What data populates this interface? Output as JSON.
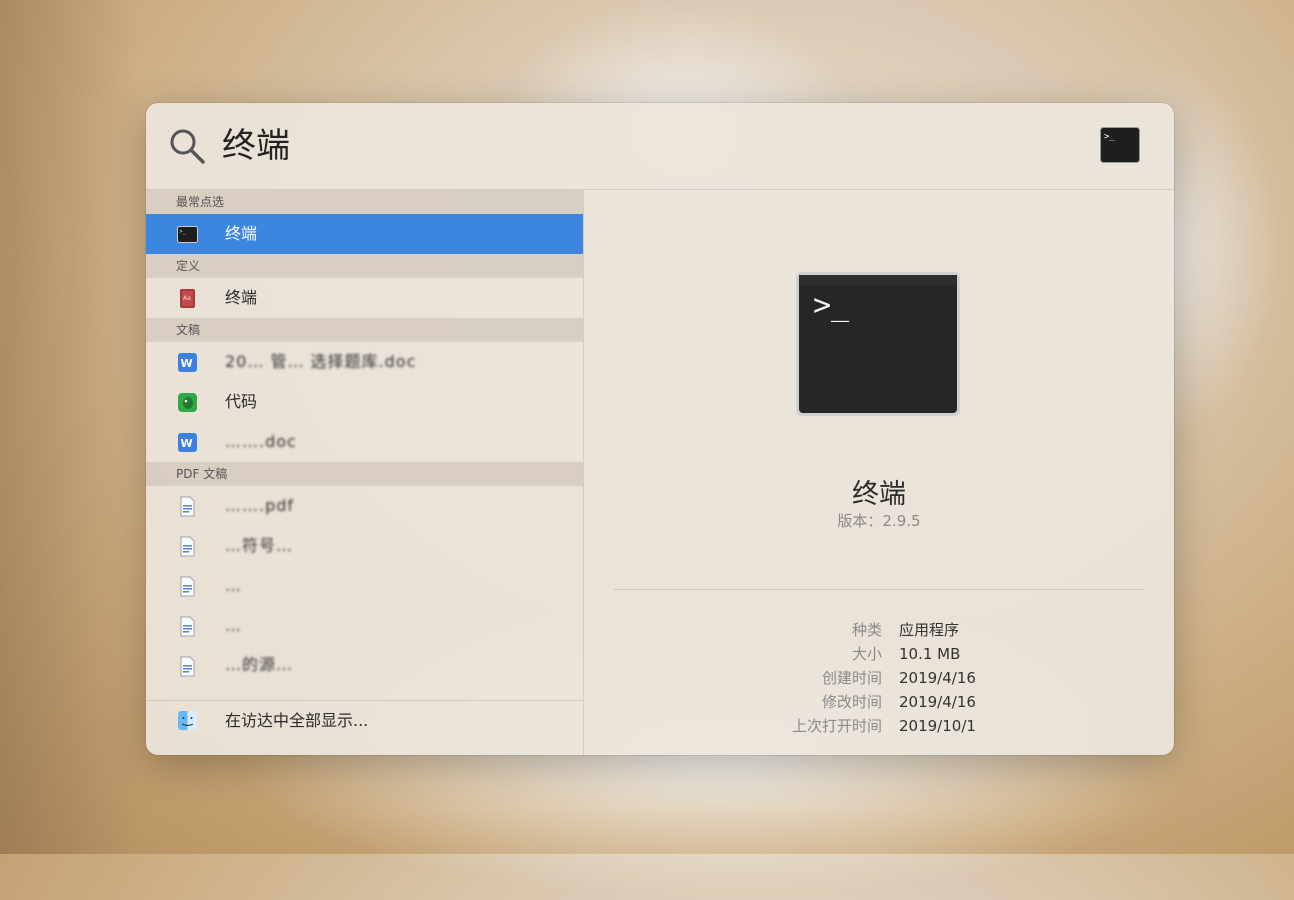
{
  "search": {
    "query": "终端"
  },
  "results": {
    "sections": [
      {
        "header": "最常点选",
        "items": [
          {
            "label": "终端",
            "icon": "terminal-icon",
            "selected": true
          }
        ]
      },
      {
        "header": "定义",
        "items": [
          {
            "label": "终端",
            "icon": "dictionary-icon"
          }
        ]
      },
      {
        "header": "文稿",
        "items": [
          {
            "label": "20… 管… 选择题库.doc",
            "icon": "word-doc-icon",
            "blurred": true
          },
          {
            "label": "代码",
            "icon": "evernote-icon"
          },
          {
            "label": "…….doc",
            "icon": "word-doc-icon",
            "blurred": true
          }
        ]
      },
      {
        "header": "PDF 文稿",
        "items": [
          {
            "label": "…….pdf",
            "icon": "pdf-file-icon",
            "blurred": true
          },
          {
            "label": "…符号…",
            "icon": "pdf-file-icon",
            "blurred": true
          },
          {
            "label": "…",
            "icon": "pdf-file-icon",
            "blurred": true
          },
          {
            "label": "…",
            "icon": "pdf-file-icon",
            "blurred": true
          },
          {
            "label": "…的源…",
            "icon": "pdf-file-icon",
            "blurred": true
          }
        ]
      }
    ],
    "show_all_in_finder": "在访达中全部显示..."
  },
  "preview": {
    "app_name": "终端",
    "version": "版本：2.9.5",
    "details": [
      {
        "key": "种类",
        "value": "应用程序"
      },
      {
        "key": "大小",
        "value": "10.1 MB"
      },
      {
        "key": "创建时间",
        "value": "2019/4/16"
      },
      {
        "key": "修改时间",
        "value": "2019/4/16"
      },
      {
        "key": "上次打开时间",
        "value": "2019/10/1"
      }
    ]
  },
  "colors": {
    "selection": "#3d86e0",
    "terminal_bg": "#262626"
  }
}
